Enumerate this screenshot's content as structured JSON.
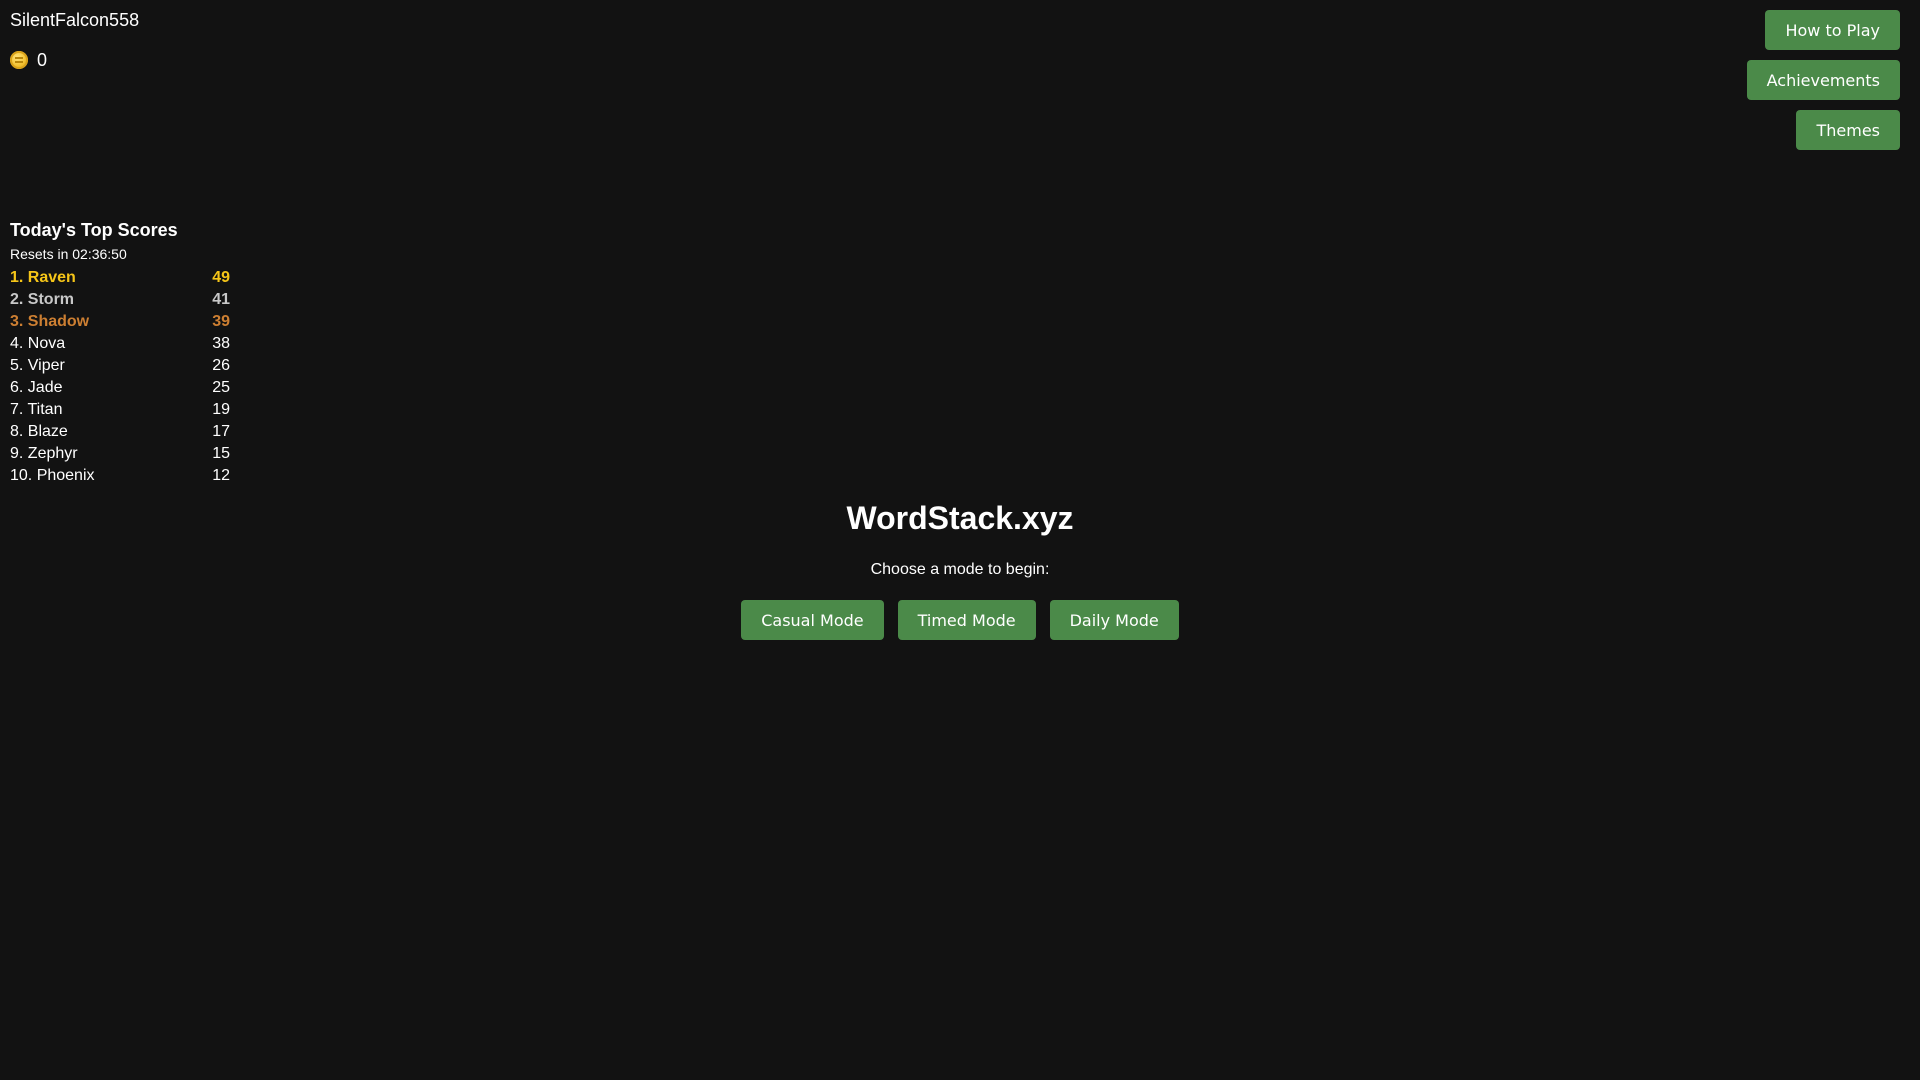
{
  "user": {
    "name": "SilentFalcon558",
    "coins": "0"
  },
  "nav": {
    "how_to_play": "How to Play",
    "achievements": "Achievements",
    "themes": "Themes"
  },
  "leaderboard": {
    "title": "Today's Top Scores",
    "reset": "Resets in 02:36:50",
    "entries": [
      {
        "label": "1. Raven",
        "score": "49"
      },
      {
        "label": "2. Storm",
        "score": "41"
      },
      {
        "label": "3. Shadow",
        "score": "39"
      },
      {
        "label": "4. Nova",
        "score": "38"
      },
      {
        "label": "5. Viper",
        "score": "26"
      },
      {
        "label": "6. Jade",
        "score": "25"
      },
      {
        "label": "7. Titan",
        "score": "19"
      },
      {
        "label": "8. Blaze",
        "score": "17"
      },
      {
        "label": "9. Zephyr",
        "score": "15"
      },
      {
        "label": "10. Phoenix",
        "score": "12"
      }
    ],
    "colors": {
      "gold": "#f5c518",
      "silver": "#c8c8c8",
      "bronze": "#cd7f32"
    }
  },
  "main": {
    "title": "WordStack.xyz",
    "subtitle": "Choose a mode to begin:",
    "modes": [
      "Casual Mode",
      "Timed Mode",
      "Daily Mode"
    ]
  },
  "theme": {
    "background": "#121212",
    "button": "#4b8a49",
    "text": "#ffffff"
  },
  "icons": {
    "coin": "coin-icon"
  }
}
